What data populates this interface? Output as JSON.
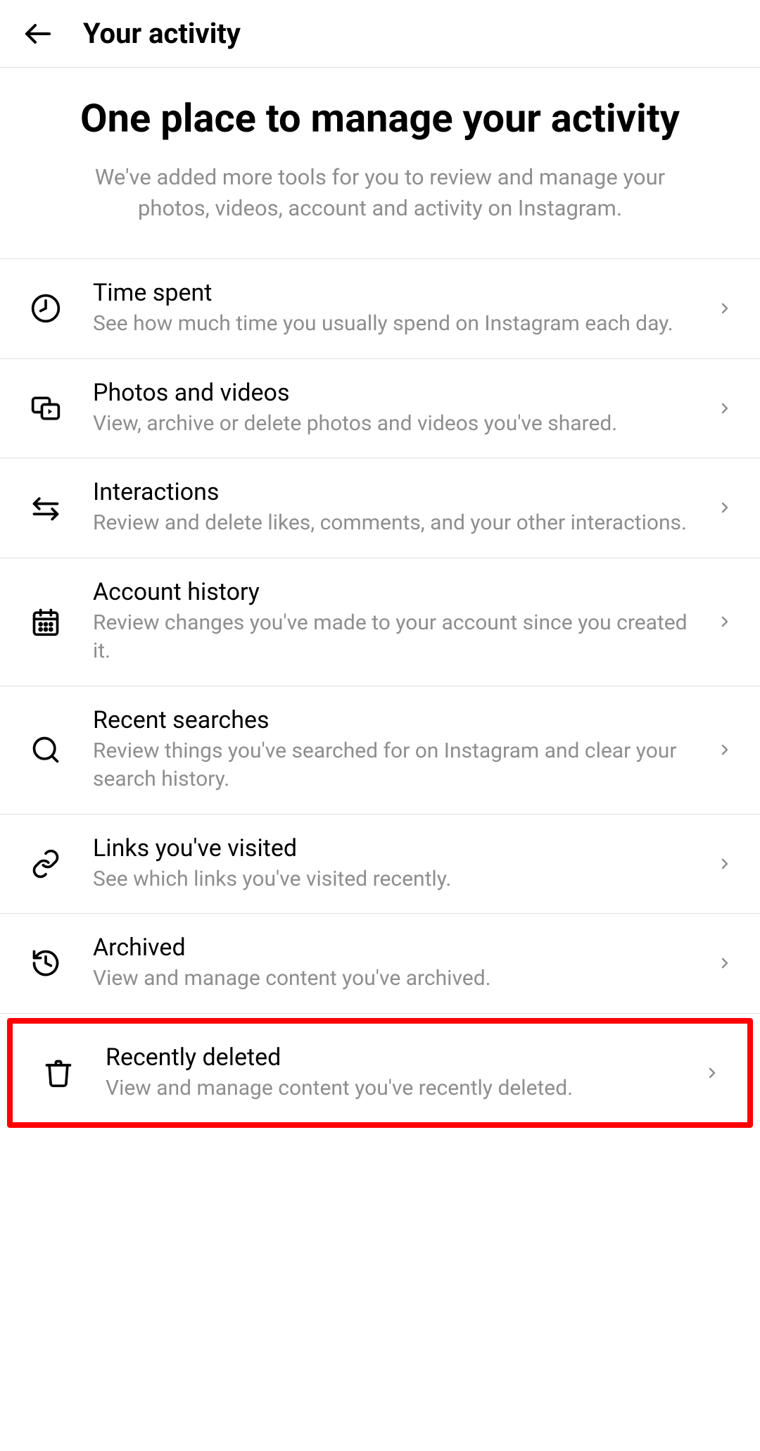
{
  "header": {
    "title": "Your activity"
  },
  "intro": {
    "heading": "One place to manage your activity",
    "subtext": "We've added more tools for you to review and manage your photos, videos, account and activity on Instagram."
  },
  "rows": {
    "time_spent": {
      "title": "Time spent",
      "subtitle": "See how much time you usually spend on Instagram each day."
    },
    "photos_videos": {
      "title": "Photos and videos",
      "subtitle": "View, archive or delete photos and videos you've shared."
    },
    "interactions": {
      "title": "Interactions",
      "subtitle": "Review and delete likes, comments, and your other interactions."
    },
    "account_history": {
      "title": "Account history",
      "subtitle": "Review changes you've made to your account since you created it."
    },
    "recent_searches": {
      "title": "Recent searches",
      "subtitle": "Review things you've searched for on Instagram and clear your search history."
    },
    "links_visited": {
      "title": "Links you've visited",
      "subtitle": "See which links you've visited recently."
    },
    "archived": {
      "title": "Archived",
      "subtitle": "View and manage content you've archived."
    },
    "recently_deleted": {
      "title": "Recently deleted",
      "subtitle": "View and manage content you've recently deleted."
    }
  }
}
